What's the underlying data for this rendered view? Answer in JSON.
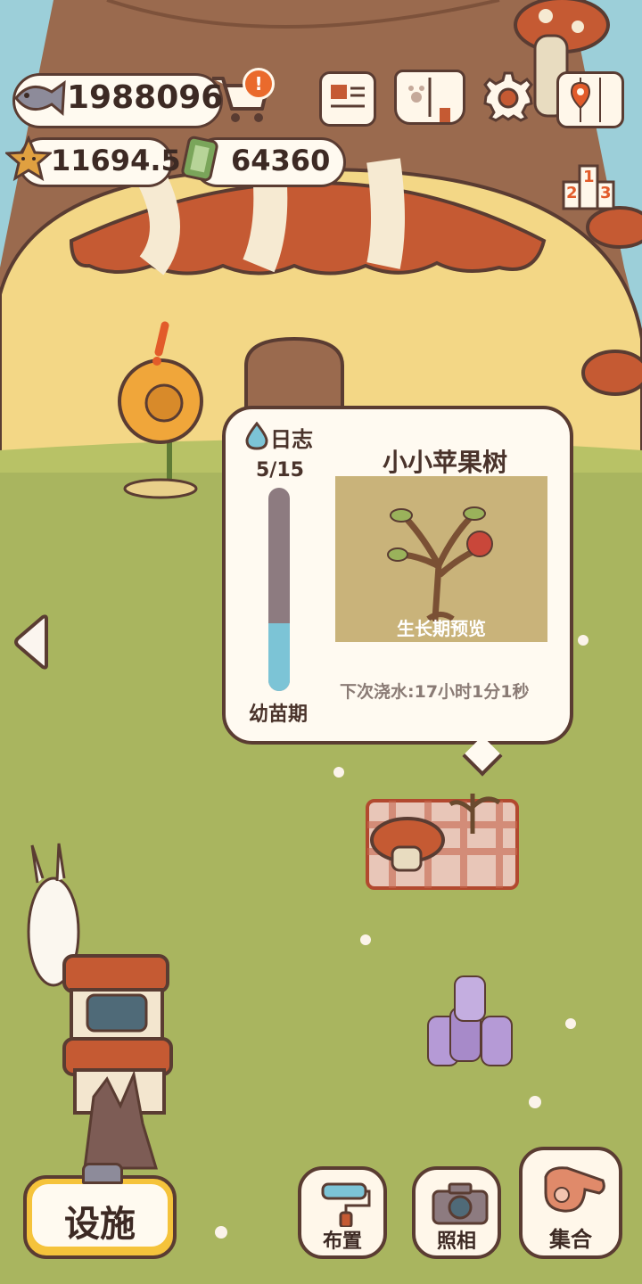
{
  "currencies": {
    "fish": "1988096",
    "stars": "11694.5",
    "tickets": "64360"
  },
  "icons": {
    "fish": "fish-icon",
    "star": "star-icon",
    "ticket": "ticket-icon",
    "shop": "shopping-cart-icon",
    "news": "newspaper-icon",
    "book": "paw-book-icon",
    "settings": "gear-icon",
    "map": "map-icon",
    "ranking": "podium-icon",
    "back": "left-arrow-icon",
    "water": "water-drop-icon"
  },
  "popup": {
    "log_label": "日志",
    "progress_text": "5/15",
    "progress_fraction": 0.333,
    "stage": "幼苗期",
    "title": "小小苹果树",
    "preview_caption": "生长期预览",
    "next_water": "下次浇水:17小时1分1秒"
  },
  "bottom": {
    "facilities": "设施",
    "layout": "布置",
    "photo": "照相",
    "gather": "集合"
  },
  "ranking_digits": [
    "2",
    "1",
    "3"
  ],
  "colors": {
    "accent_yellow": "#f5c33b",
    "outline": "#5a3c32",
    "progress_fill": "#7cc4d6",
    "progress_track": "#8d7b80"
  }
}
